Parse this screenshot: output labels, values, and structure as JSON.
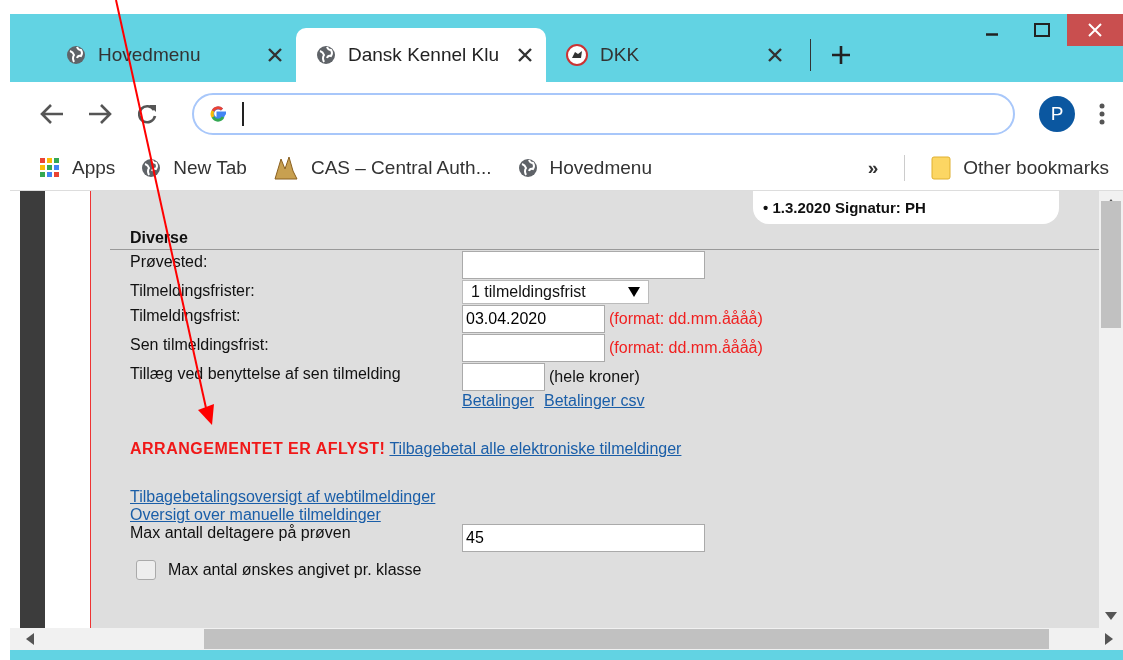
{
  "tabs": [
    {
      "title": "Hovedmenu",
      "kind": "globe",
      "selected": false
    },
    {
      "title": "Dansk Kennel Klu",
      "kind": "globe",
      "selected": true
    },
    {
      "title": "DKK",
      "kind": "badge",
      "selected": false
    }
  ],
  "bookmarks": [
    {
      "label": "Apps",
      "kind": "apps"
    },
    {
      "label": "New Tab",
      "kind": "globe"
    },
    {
      "label": "CAS – Central Auth...",
      "kind": "logo"
    },
    {
      "label": "Hovedmenu",
      "kind": "globe"
    }
  ],
  "bookmarks_overflow": "»",
  "other_bookmarks": "Other bookmarks",
  "profile": {
    "initial": "P"
  },
  "note_card": {
    "text": "• 1.3.2020 Signatur: PH"
  },
  "section": {
    "title": "Diverse"
  },
  "fields": [
    {
      "label": "Prøvested:",
      "kind": "text"
    },
    {
      "label": "Tilmeldingsfrister:",
      "kind": "select",
      "value": "1 tilmeldingsfrist"
    },
    {
      "label": "Tilmeldingsfrist:",
      "kind": "date",
      "value": "03.04.2020",
      "hint": "(format: dd.mm.åååå)"
    },
    {
      "label": "Sen tilmeldingsfrist:",
      "kind": "date",
      "hint": "(format: dd.mm.åååå)"
    },
    {
      "label": "Tillæg ved benyttelse af sen tilmelding",
      "kind": "amount",
      "hint": "(hele kroner)"
    }
  ],
  "payment_links": [
    "Betalinger",
    "Betalinger csv"
  ],
  "cancel_notice": {
    "alert": "ARRANGEMENTET ER AFLYST!",
    "link": "Tilbagebetal alle elektroniske tilmeldinger"
  },
  "overview_links": [
    "Tilbagebetalingsoversigt af webtilmeldinger",
    "Oversigt over manuelle tilmeldinger"
  ],
  "max_field": {
    "label": "Max antall deltagere på prøven",
    "value": "45"
  },
  "max_checkbox": {
    "label": "Max antal ønskes angivet pr. klasse",
    "checked": false
  }
}
